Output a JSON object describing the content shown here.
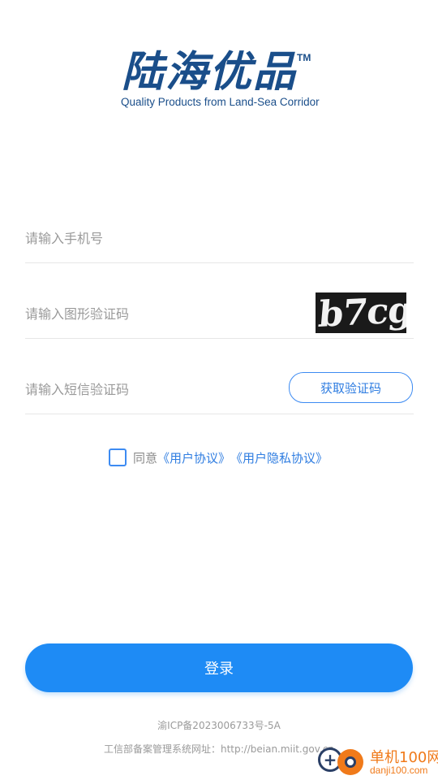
{
  "logo": {
    "cn": "陆海优品",
    "tm": "TM",
    "en": "Quality Products from Land-Sea Corridor"
  },
  "form": {
    "phone_placeholder": "请输入手机号",
    "captcha_placeholder": "请输入图形验证码",
    "captcha_image_text": "b7cg",
    "sms_placeholder": "请输入短信验证码",
    "get_code_label": "获取验证码"
  },
  "agreement": {
    "checked": false,
    "prefix": "同意",
    "user_agreement": "《用户协议》",
    "privacy_agreement": "《用户隐私协议》"
  },
  "login": {
    "label": "登录"
  },
  "footer": {
    "icp": "渝ICP备2023006733号-5A",
    "beian": "工信部备案管理系统网址：http://beian.miit.gov.cn"
  },
  "watermark": {
    "brand": "单机100网",
    "url": "danji100.com"
  },
  "colors": {
    "primary": "#1e8bf5",
    "link": "#2f7de1",
    "logo": "#1a4e8a",
    "muted": "#9a9a9a"
  }
}
